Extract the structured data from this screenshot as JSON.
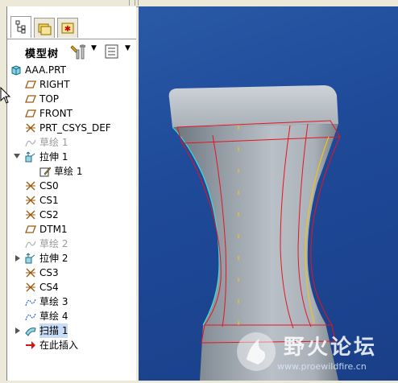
{
  "tabs": [
    {
      "icon": "model-tree-tab-icon"
    },
    {
      "icon": "folder-browser-tab-icon"
    },
    {
      "icon": "favorites-tab-icon"
    }
  ],
  "toolbar": {
    "title": "模型树",
    "settings_icon": "tools-icon",
    "columns_icon": "show-columns-icon"
  },
  "tree": [
    {
      "label": "AAA.PRT",
      "icon": "part-icon",
      "indent": 0,
      "state": "normal"
    },
    {
      "label": "RIGHT",
      "icon": "datum-plane-icon",
      "indent": 1,
      "state": "normal"
    },
    {
      "label": "TOP",
      "icon": "datum-plane-icon",
      "indent": 1,
      "state": "normal"
    },
    {
      "label": "FRONT",
      "icon": "datum-plane-icon",
      "indent": 1,
      "state": "normal"
    },
    {
      "label": "PRT_CSYS_DEF",
      "icon": "csys-icon",
      "indent": 1,
      "state": "normal"
    },
    {
      "label": "草绘 1",
      "icon": "sketch-icon",
      "indent": 1,
      "state": "grayed"
    },
    {
      "label": "拉伸 1",
      "icon": "extrude-icon",
      "indent": 1,
      "state": "expanded"
    },
    {
      "label": "草绘 1",
      "icon": "sketch-edit-icon",
      "indent": 2,
      "state": "normal"
    },
    {
      "label": "CS0",
      "icon": "csys-icon",
      "indent": 1,
      "state": "normal"
    },
    {
      "label": "CS1",
      "icon": "csys-icon",
      "indent": 1,
      "state": "normal"
    },
    {
      "label": "CS2",
      "icon": "csys-icon",
      "indent": 1,
      "state": "normal"
    },
    {
      "label": "DTM1",
      "icon": "datum-plane-icon",
      "indent": 1,
      "state": "normal"
    },
    {
      "label": "草绘 2",
      "icon": "sketch-icon",
      "indent": 1,
      "state": "grayed"
    },
    {
      "label": "拉伸 2",
      "icon": "extrude-icon",
      "indent": 1,
      "state": "collapsed"
    },
    {
      "label": "CS3",
      "icon": "csys-icon",
      "indent": 1,
      "state": "normal"
    },
    {
      "label": "CS4",
      "icon": "csys-icon",
      "indent": 1,
      "state": "normal"
    },
    {
      "label": "草绘 3",
      "icon": "sketch-icon",
      "indent": 1,
      "state": "normal"
    },
    {
      "label": "草绘 4",
      "icon": "sketch-icon",
      "indent": 1,
      "state": "normal"
    },
    {
      "label": "扫描 1",
      "icon": "sweep-icon",
      "indent": 1,
      "state": "collapsed-selected"
    },
    {
      "label": "在此插入",
      "icon": "insert-here-arrow-icon",
      "indent": 1,
      "state": "normal"
    }
  ],
  "watermark": {
    "title": "野火论坛",
    "url": "www.proewildfire.cn"
  },
  "colors": {
    "viewport_bg": "#1e4a99",
    "model": "#9aa3ad",
    "edge_red": "#e8141e",
    "edge_yellow": "#f2c21a",
    "edge_cyan": "#33e0e0"
  }
}
